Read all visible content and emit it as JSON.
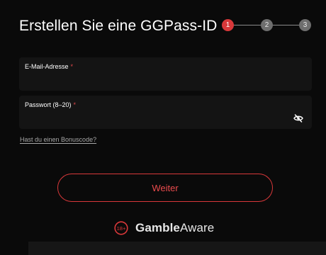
{
  "header": {
    "title": "Erstellen Sie eine GGPass-ID"
  },
  "stepper": {
    "steps": [
      "1",
      "2",
      "3"
    ],
    "current": 1,
    "active_color": "#d9383a",
    "pending_color": "#6e6e6e"
  },
  "form": {
    "email": {
      "label": "E-Mail-Adresse",
      "required_mark": "*",
      "value": "",
      "placeholder": ""
    },
    "password": {
      "label": "Passwort (8–20)",
      "required_mark": "*",
      "value": "",
      "placeholder": "",
      "toggle_icon": "eye-off-icon"
    },
    "bonus_link": "Hast du einen Bonuscode?",
    "submit_label": "Weiter"
  },
  "footer": {
    "logo_badge": "18+",
    "brand_part1": "Gamble",
    "brand_part2": "Aware",
    "brand_color": "#d9383a"
  }
}
